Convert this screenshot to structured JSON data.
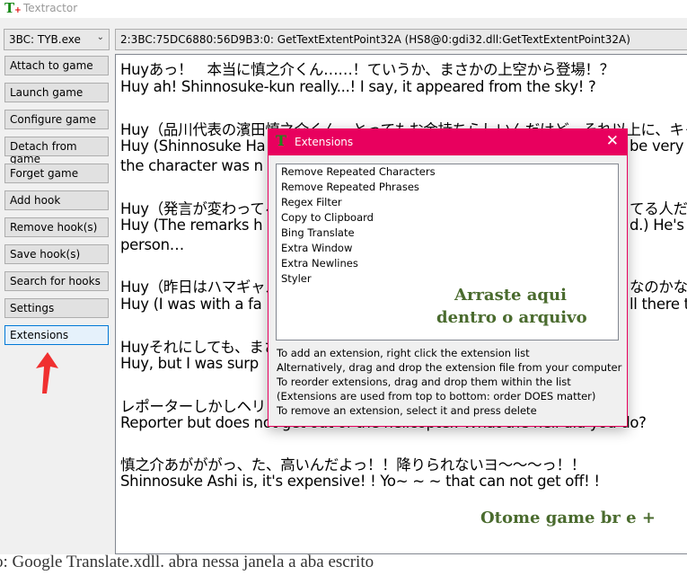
{
  "window": {
    "title": "Textractor",
    "logo": "T"
  },
  "process_combo": {
    "value": "3BC: TYB.exe"
  },
  "hook_combo": {
    "value": "2:3BC:75DC6880:56D9B3:0: GetTextExtentPoint32A (HS8@0:gdi32.dll:GetTextExtentPoint32A)"
  },
  "buttons": [
    "Attach to game",
    "Launch game",
    "Configure game",
    "Detach from game",
    "Forget game",
    "Add hook",
    "Remove hook(s)",
    "Save hook(s)",
    "Search for hooks",
    "Settings",
    "Extensions"
  ],
  "text_lines": [
    "Huyあっ！　本当に慎之介くん……！ていうか、まさかの上空から登場！？",
    "Huy ah!  Shinnosuke-kun really...! I say, it appeared from the sky! ?",
    "Huy（品川代表の濱田慎之介くん。とってもお金持ちらしいんだけど、それ以上に、キャラの強さ",
    "Huy (Shinnosuke Ha",
    "be very",
    "the character was n",
    "Huy（発言が変わってる",
    "てる人だよ",
    "Huy (The remarks h",
    "d.)  He's",
    "person…",
    "Huy（昨日はハマギャル",
    "なのかな",
    "Huy (I was with a fa",
    "ll there t",
    "Huyそれにしても、まさか",
    "Huy, but I was surp",
    "レポーターしかしヘリコプタ",
    "Reporter but does not get out of the helicopter. What the hell did you do?",
    "慎之介あがががっ、た、高いんだよっ！！降りられないヨ〜〜〜っ！！",
    "Shinnosuke Ashi is, it's expensive! ! Yo~ ~ ~ that can not get off! !"
  ],
  "watermarks": {
    "drop_hint_1": "Arraste aqui",
    "drop_hint_2": "dentro o arquivo",
    "brand": "Otome game br e +"
  },
  "bottom_text": "o: Google Translate.xdll. abra nessa janela a aba escrito",
  "dialog": {
    "title": "Extensions",
    "close": "✕",
    "extensions": [
      "Remove Repeated Characters",
      "Remove Repeated Phrases",
      "Regex Filter",
      "Copy to Clipboard",
      "Bing Translate",
      "Extra Window",
      "Extra Newlines",
      "Styler"
    ],
    "info": [
      "To add an extension, right click the extension list",
      "Alternatively, drag and drop the extension file from your computer",
      "To reorder extensions, drag and drop them within the list",
      "(Extensions are used from top to bottom: order DOES matter)",
      "To remove an extension, select it and press delete"
    ]
  },
  "colors": {
    "dialog_accent": "#e8005e",
    "arrow": "#f03030",
    "watermark": "#4a6b2e"
  }
}
